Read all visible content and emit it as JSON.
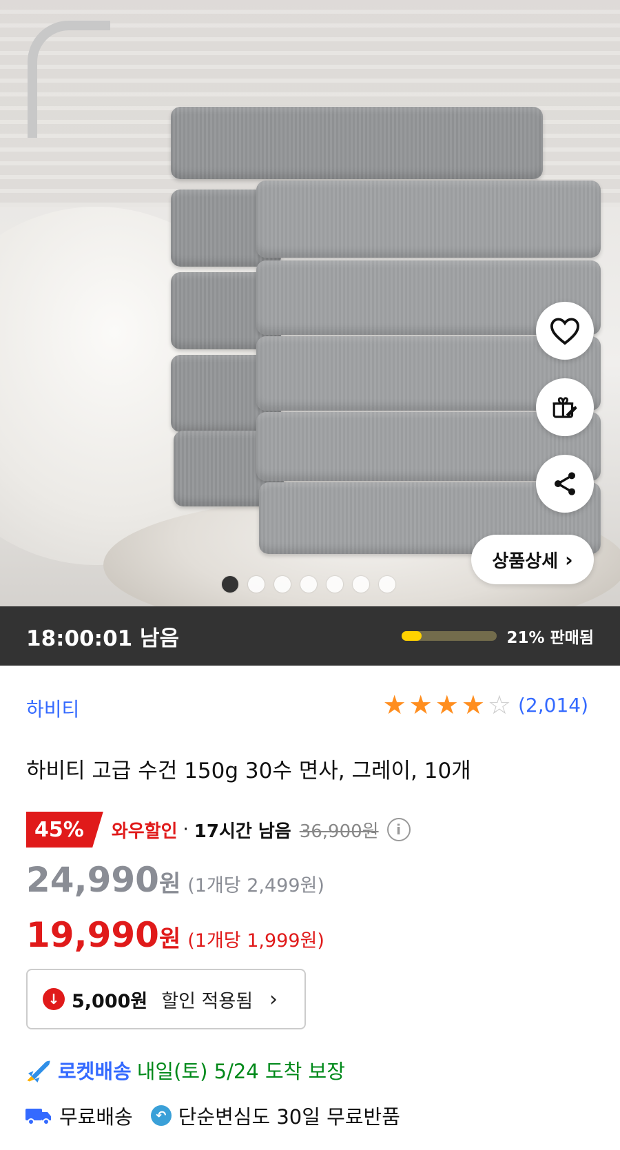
{
  "hero": {
    "details_label": "상품상세",
    "pagination": {
      "current": 1,
      "total": 7
    }
  },
  "timer": {
    "remaining": "18:00:01 남음",
    "sold_percent": 21,
    "sold_label": "21% 판매됨"
  },
  "product": {
    "brand": "하비티",
    "rating": {
      "stars": 4,
      "max": 5,
      "count": "(2,014)"
    },
    "title": "하비티 고급 수건 150g 30수 면사, 그레이, 10개"
  },
  "promo": {
    "discount_badge": "45%",
    "label": "와우할인",
    "separator": "·",
    "time_left": "17시간 남음",
    "original_price": "36,900원"
  },
  "prices": {
    "regular": {
      "amount": "24,990",
      "currency": "원",
      "unit_price": "(1개당 2,499원)"
    },
    "wow": {
      "amount": "19,990",
      "currency": "원",
      "unit_price": "(1개당 1,999원)"
    }
  },
  "coupon": {
    "amount": "5,000원",
    "text": "할인 적용됨"
  },
  "delivery": {
    "rocket_label": "로켓배송",
    "arrival": "내일(토) 5/24 도착 보장",
    "free_shipping": "무료배송",
    "free_return": "단순변심도 30일 무료반품"
  },
  "colors": {
    "accent_blue": "#346aff",
    "sale_red": "#e01a1a",
    "star_orange": "#ff8e1f",
    "timer_bg": "#333333",
    "progress_yellow": "#ffd200"
  }
}
